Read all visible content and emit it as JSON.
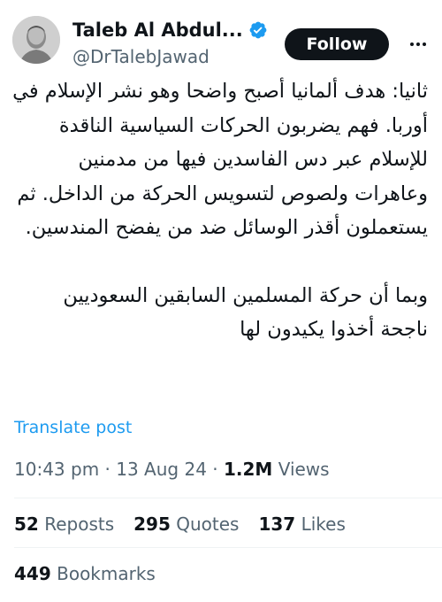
{
  "author": {
    "display_name": "Taleb Al Abdul...",
    "handle": "@DrTalebJawad",
    "verified_icon": "verified-badge-icon",
    "follow_label": "Follow"
  },
  "tweet": {
    "paragraph_1": "ثانيا: هدف ألمانيا أصبح واضحا وهو نشر الإسلام في أوربا. فهم يضربون الحركات السياسية الناقدة للإسلام عبر دس الفاسدين فيها من مدمنين وعاهرات ولصوص لتسويس الحركة من الداخل. ثم يستعملون أقذر الوسائل ضد من يفضح المندسين.",
    "paragraph_2": "وبما أن حركة المسلمين السابقين السعوديين ناجحة أخذوا يكيدون لها",
    "translate_label": "Translate post"
  },
  "meta": {
    "time": "10:43 pm",
    "date": "13 Aug 24",
    "views_count": "1.2M",
    "views_label": "Views"
  },
  "stats": {
    "reposts_count": "52",
    "reposts_label": "Reposts",
    "quotes_count": "295",
    "quotes_label": "Quotes",
    "likes_count": "137",
    "likes_label": "Likes",
    "bookmarks_count": "449",
    "bookmarks_label": "Bookmarks"
  },
  "colors": {
    "link": "#1d9bf0",
    "text_primary": "#0f1419",
    "text_secondary": "#536471",
    "follow_bg": "#0f1419"
  }
}
